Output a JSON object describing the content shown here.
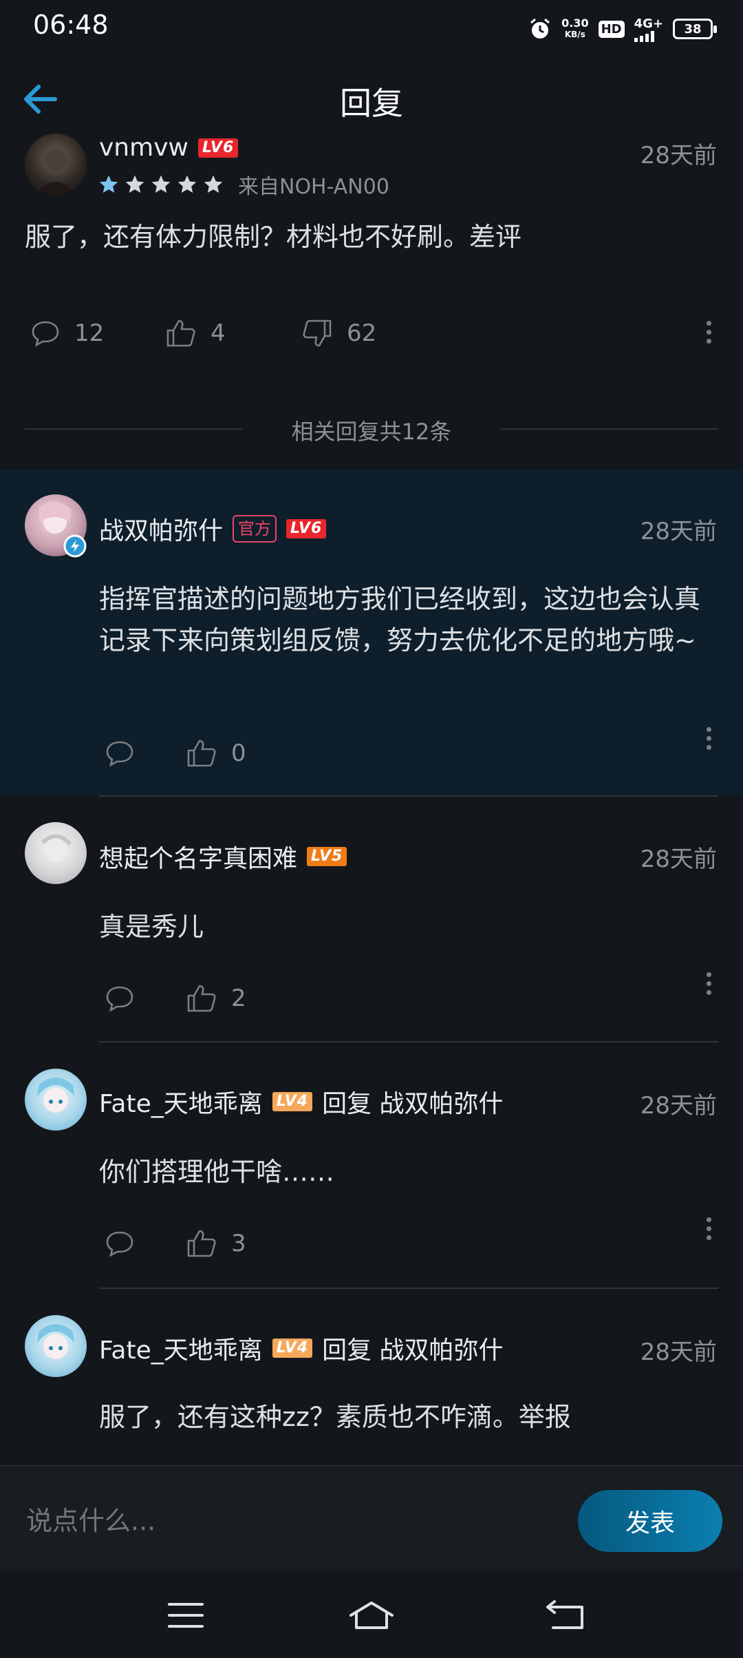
{
  "status_bar": {
    "time": "06:48",
    "net_speed_value": "0.30",
    "net_speed_unit": "KB/s",
    "hd": "HD",
    "network": "4G+",
    "battery": "38"
  },
  "header": {
    "title": "回复"
  },
  "main_post": {
    "username": "vnmvw",
    "level": "LV6",
    "rating_stars": 5,
    "device": "来自NOH-AN00",
    "time": "28天前",
    "content": "服了，还有体力限制？材料也不好刷。差评",
    "comments_count": "12",
    "likes_count": "4",
    "dislikes_count": "62"
  },
  "replies_divider": "相关回复共12条",
  "replies": [
    {
      "username": "战双帕弥什",
      "official_tag": "官方",
      "level": "LV6",
      "time": "28天前",
      "content": "指挥官描述的问题地方我们已经收到，这边也会认真记录下来向策划组反馈，努力去优化不足的地方哦~",
      "likes": "0"
    },
    {
      "username": "想起个名字真困难",
      "level": "LV5",
      "time": "28天前",
      "content": "真是秀儿",
      "likes": "2"
    },
    {
      "username": "Fate_天地乖离",
      "level": "LV4",
      "reply_to": "回复 战双帕弥什",
      "time": "28天前",
      "content": "你们搭理他干啥……",
      "likes": "3"
    },
    {
      "username": "Fate_天地乖离",
      "level": "LV4",
      "reply_to": "回复 战双帕弥什",
      "time": "28天前",
      "content": "服了，还有这种zz？素质也不咋滴。举报"
    }
  ],
  "reply_bar": {
    "placeholder": "说点什么...",
    "send_label": "发表"
  },
  "colors": {
    "background": "#13171b",
    "official_bg": "#0e1f2b",
    "accent": "#2a9bd6",
    "lv6": "#e8262c",
    "lv5": "#f07c16",
    "lv4": "#f5a85a"
  }
}
